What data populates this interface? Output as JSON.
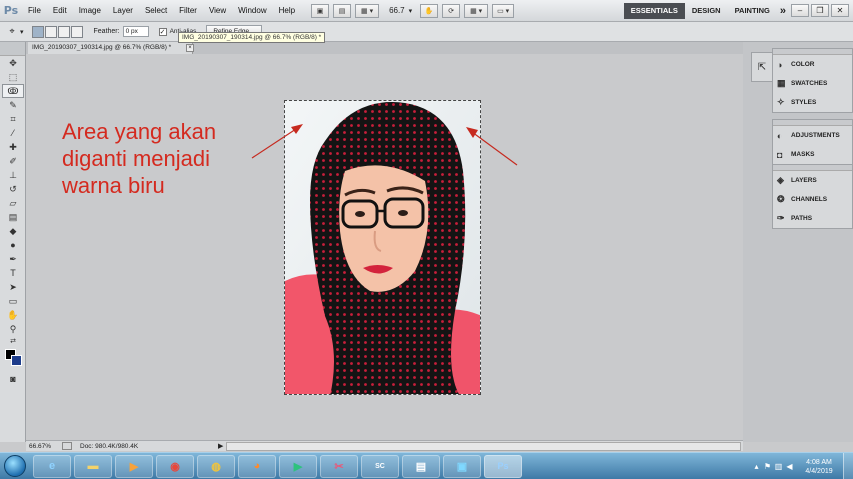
{
  "menubar": {
    "logo": "Ps",
    "items": [
      "File",
      "Edit",
      "Image",
      "Layer",
      "Select",
      "Filter",
      "View",
      "Window",
      "Help"
    ],
    "zoom": "66.7",
    "workspaces": [
      "ESSENTIALS",
      "DESIGN",
      "PAINTING"
    ],
    "more": "»"
  },
  "options": {
    "feather_label": "Feather:",
    "feather_value": "0 px",
    "antialias_label": "Anti-alias",
    "refine_label": "Refine Edge..."
  },
  "document": {
    "tab_title": "IMG_20190307_190314.jpg @ 66.7% (RGB/8) *",
    "tooltip": "IMG_20190307_190314.jpg @ 66.7% (RGB/8) *"
  },
  "annotation": {
    "lines": [
      "Area yang akan",
      "diganti menjadi",
      "warna biru"
    ],
    "color": "#d42a1f"
  },
  "status": {
    "zoom": "66.67%",
    "doc": "Doc: 980.4K/980.4K"
  },
  "panels": {
    "group1": [
      {
        "icon": "color-icon",
        "label": "COLOR"
      },
      {
        "icon": "swatches-icon",
        "label": "SWATCHES"
      },
      {
        "icon": "styles-icon",
        "label": "STYLES"
      }
    ],
    "group2": [
      {
        "icon": "adjustments-icon",
        "label": "ADJUSTMENTS"
      },
      {
        "icon": "masks-icon",
        "label": "MASKS"
      }
    ],
    "group3": [
      {
        "icon": "layers-icon",
        "label": "LAYERS"
      },
      {
        "icon": "channels-icon",
        "label": "CHANNELS"
      },
      {
        "icon": "paths-icon",
        "label": "PATHS"
      }
    ]
  },
  "taskbar": {
    "clock_time": "4:08 AM",
    "clock_date": "4/4/2019",
    "ps_label": "Ps"
  },
  "colors": {
    "foreground": "#000000",
    "background": "#1d3c8b"
  }
}
